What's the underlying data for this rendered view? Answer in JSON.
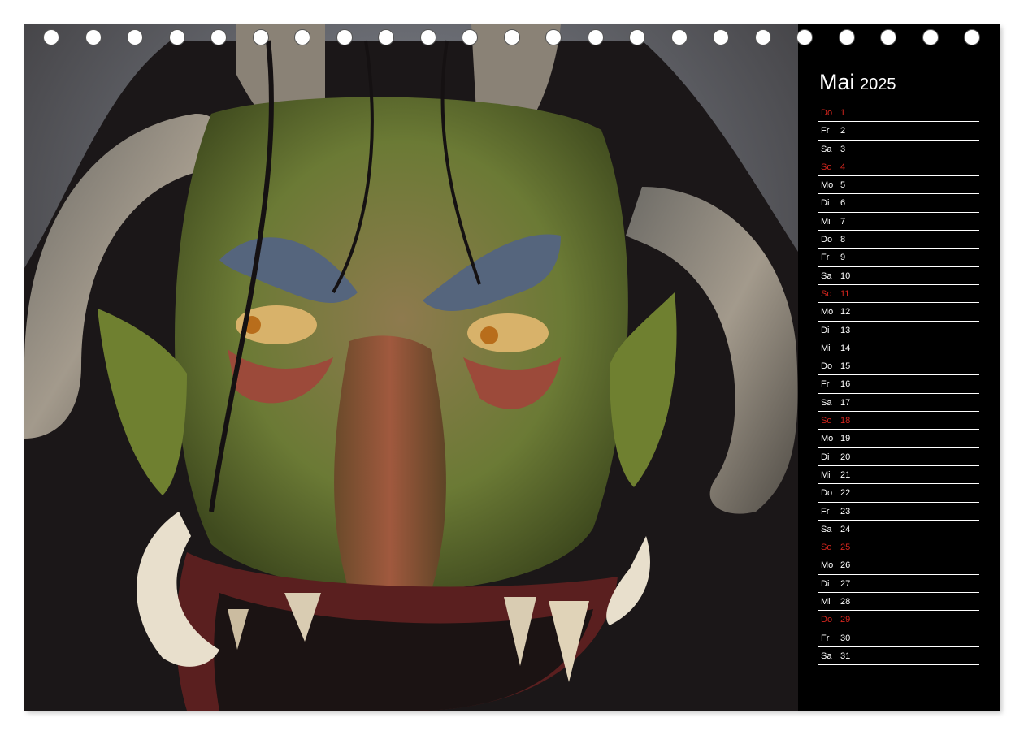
{
  "calendar": {
    "month": "Mai",
    "year": "2025",
    "days": [
      {
        "weekday": "Do",
        "day": "1",
        "holiday": true
      },
      {
        "weekday": "Fr",
        "day": "2",
        "holiday": false
      },
      {
        "weekday": "Sa",
        "day": "3",
        "holiday": false
      },
      {
        "weekday": "So",
        "day": "4",
        "holiday": true
      },
      {
        "weekday": "Mo",
        "day": "5",
        "holiday": false
      },
      {
        "weekday": "Di",
        "day": "6",
        "holiday": false
      },
      {
        "weekday": "Mi",
        "day": "7",
        "holiday": false
      },
      {
        "weekday": "Do",
        "day": "8",
        "holiday": false
      },
      {
        "weekday": "Fr",
        "day": "9",
        "holiday": false
      },
      {
        "weekday": "Sa",
        "day": "10",
        "holiday": false
      },
      {
        "weekday": "So",
        "day": "11",
        "holiday": true
      },
      {
        "weekday": "Mo",
        "day": "12",
        "holiday": false
      },
      {
        "weekday": "Di",
        "day": "13",
        "holiday": false
      },
      {
        "weekday": "Mi",
        "day": "14",
        "holiday": false
      },
      {
        "weekday": "Do",
        "day": "15",
        "holiday": false
      },
      {
        "weekday": "Fr",
        "day": "16",
        "holiday": false
      },
      {
        "weekday": "Sa",
        "day": "17",
        "holiday": false
      },
      {
        "weekday": "So",
        "day": "18",
        "holiday": true
      },
      {
        "weekday": "Mo",
        "day": "19",
        "holiday": false
      },
      {
        "weekday": "Di",
        "day": "20",
        "holiday": false
      },
      {
        "weekday": "Mi",
        "day": "21",
        "holiday": false
      },
      {
        "weekday": "Do",
        "day": "22",
        "holiday": false
      },
      {
        "weekday": "Fr",
        "day": "23",
        "holiday": false
      },
      {
        "weekday": "Sa",
        "day": "24",
        "holiday": false
      },
      {
        "weekday": "So",
        "day": "25",
        "holiday": true
      },
      {
        "weekday": "Mo",
        "day": "26",
        "holiday": false
      },
      {
        "weekday": "Di",
        "day": "27",
        "holiday": false
      },
      {
        "weekday": "Mi",
        "day": "28",
        "holiday": false
      },
      {
        "weekday": "Do",
        "day": "29",
        "holiday": true
      },
      {
        "weekday": "Fr",
        "day": "30",
        "holiday": false
      },
      {
        "weekday": "Sa",
        "day": "31",
        "holiday": false
      }
    ]
  },
  "colors": {
    "holiday": "#d4261e",
    "panel": "#000000",
    "text": "#ffffff"
  },
  "binding": {
    "hole_count": 23
  }
}
